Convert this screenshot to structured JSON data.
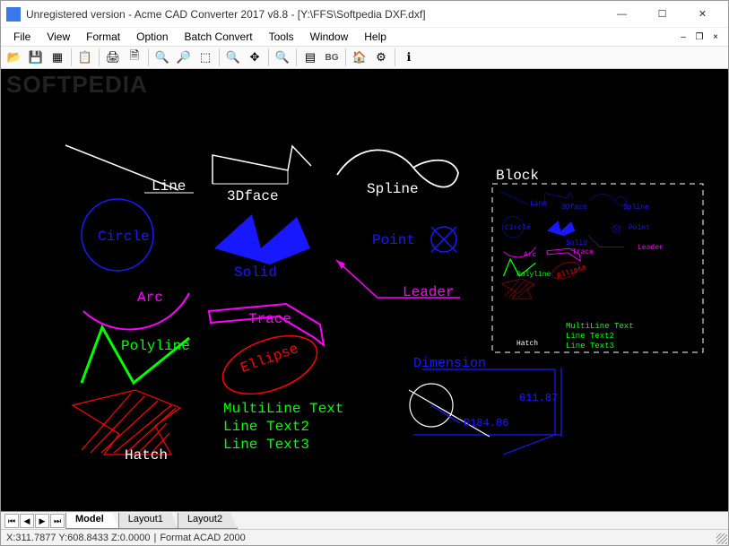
{
  "window": {
    "title": "Unregistered version - Acme CAD Converter 2017 v8.8 - [Y:\\FFS\\Softpedia DXF.dxf]"
  },
  "menu": {
    "items": [
      "File",
      "View",
      "Format",
      "Option",
      "Batch Convert",
      "Tools",
      "Window",
      "Help"
    ]
  },
  "toolbar": {
    "bg_label": "BG"
  },
  "watermark": "SOFTPEDIA",
  "canvas": {
    "labels": {
      "line": "Line",
      "face3d": "3Dface",
      "spline": "Spline",
      "circle": "Circle",
      "solid": "Solid",
      "point": "Point",
      "arc": "Arc",
      "trace": "Trace",
      "leader": "Leader",
      "polyline": "Polyline",
      "ellipse": "Ellipse",
      "mtext1": "MultiLine Text",
      "mtext2": "Line Text2",
      "mtext3": "Line Text3",
      "hatch": "Hatch",
      "dimension": "Dimension",
      "dim_value": "611.87",
      "dim_radius": "R184.06",
      "block": "Block"
    },
    "block_mini": {
      "line": "Line",
      "face3d": "3Dface",
      "spline": "Spline",
      "circle": "Circle",
      "solid": "Solid",
      "point": "Point",
      "arc": "Arc",
      "trace": "Trace",
      "leader": "Leader",
      "polyline": "Polyline",
      "ellipse": "Ellipse",
      "mtext1": "MultiLine Text",
      "mtext2": "Line Text2",
      "mtext3": "Line Text3",
      "hatch": "Hatch"
    }
  },
  "tabs": {
    "items": [
      "Model",
      "Layout1",
      "Layout2"
    ],
    "active": 0
  },
  "status": {
    "coords": "X:311.7877 Y:608.8433 Z:0.0000",
    "format": "Format ACAD 2000"
  },
  "colors": {
    "white": "#ffffff",
    "blue": "#0000ff",
    "magenta": "#ff00ff",
    "green": "#00ff00",
    "red": "#ff0000",
    "bluebright": "#2020ff"
  }
}
